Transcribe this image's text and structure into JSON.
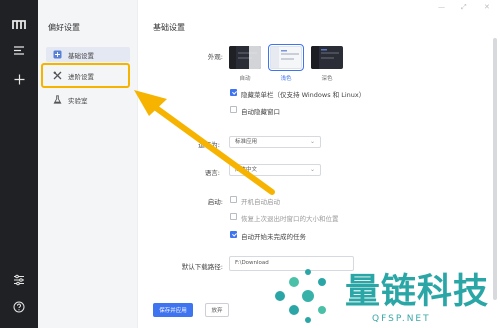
{
  "rail": {
    "logo": "m",
    "menu_icon": "menu-icon",
    "add_icon": "plus-icon",
    "settings_icon": "sliders-icon",
    "help_icon": "help-icon"
  },
  "sidebar": {
    "title": "偏好设置",
    "items": [
      {
        "label": "基础设置",
        "icon": "grid-icon",
        "active": true
      },
      {
        "label": "进阶设置",
        "icon": "tools-icon",
        "active": false
      },
      {
        "label": "实验室",
        "icon": "flask-icon",
        "active": false
      }
    ]
  },
  "main": {
    "title": "基础设置",
    "appearance": {
      "label": "外观:",
      "options": [
        {
          "label": "自动",
          "selected": false
        },
        {
          "label": "浅色",
          "selected": true
        },
        {
          "label": "深色",
          "selected": false
        }
      ]
    },
    "hide_menu": "隐藏菜单栏（仅支持 Windows 和 Linux）",
    "auto_hide": "自动隐藏窗口",
    "run_as": {
      "label": "运行为:",
      "value": "标准应用"
    },
    "language": {
      "label": "语言:",
      "value": "简体中文"
    },
    "startup": {
      "label": "启动:",
      "options": [
        {
          "label": "开机自动启动",
          "checked": false
        },
        {
          "label": "恢复上次退出时窗口的大小和位置",
          "checked": false
        },
        {
          "label": "自动开始未完成的任务",
          "checked": true
        }
      ]
    },
    "download_path": {
      "label": "默认下载路径:",
      "value": "F:\\Download"
    },
    "save_button": "保存并应用",
    "discard_button": "放弃"
  },
  "overlay": {
    "accent": "#f6b300",
    "watermark": "量链科技",
    "watermark_sub": "QFSP.NET"
  }
}
